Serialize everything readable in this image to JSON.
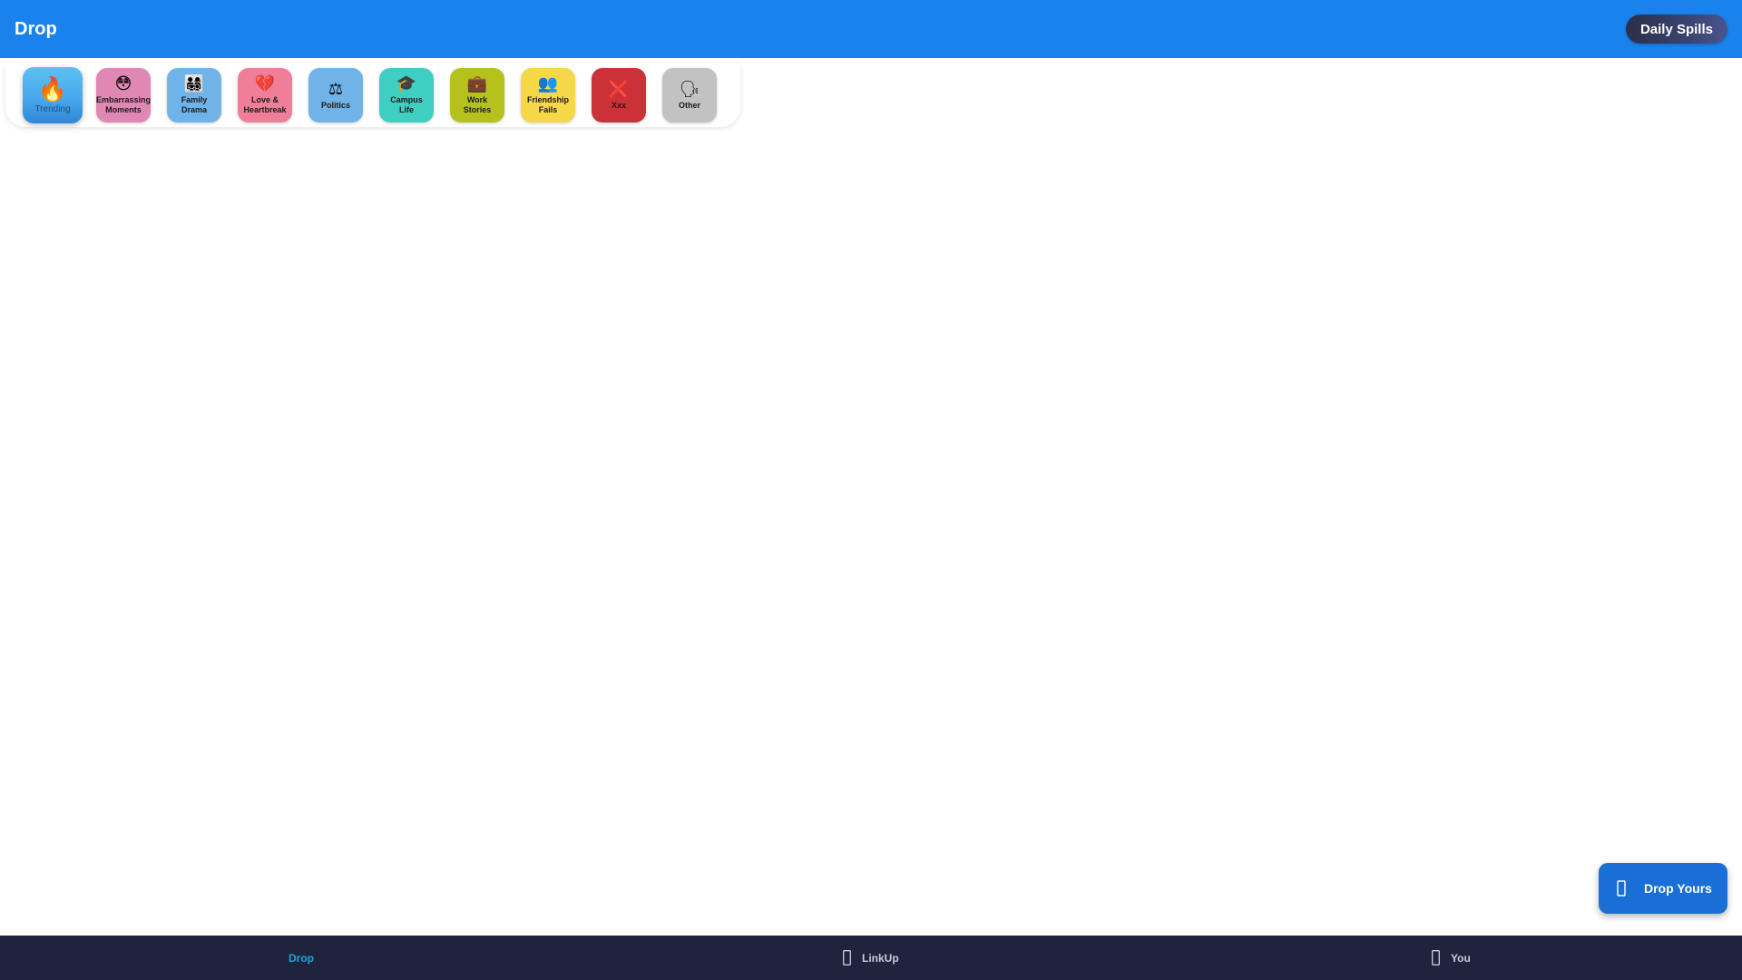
{
  "header": {
    "title": "Drop",
    "daily_spills_label": "Daily Spills"
  },
  "categories": [
    {
      "label": "Trending",
      "emoji": "🔥",
      "icon": "fire-icon",
      "color": "#4aa8ec",
      "active": true
    },
    {
      "label": "Embarrassing\nMoments",
      "emoji": "😳",
      "icon": "flushed-face-icon",
      "color": "#e088b4",
      "active": false
    },
    {
      "label": "Family\nDrama",
      "emoji": "👨‍👩‍👧‍👦",
      "icon": "family-icon",
      "color": "#6fb3e8",
      "active": false
    },
    {
      "label": "Love &\nHeartbreak",
      "emoji": "💔",
      "icon": "broken-heart-icon",
      "color": "#f07e98",
      "active": false
    },
    {
      "label": "Politics",
      "emoji": "⚖",
      "icon": "scales-icon",
      "color": "#6fb3e8",
      "active": false
    },
    {
      "label": "Campus\nLife",
      "emoji": "🎓",
      "icon": "graduation-cap-icon",
      "color": "#3fcfc2",
      "active": false
    },
    {
      "label": "Work\nStories",
      "emoji": "💼",
      "icon": "briefcase-icon",
      "color": "#b5c21e",
      "active": false
    },
    {
      "label": "Friendship\nFails",
      "emoji": "👥",
      "icon": "people-icon",
      "color": "#f6d748",
      "active": false
    },
    {
      "label": "Xxx",
      "emoji": "❌",
      "icon": "cross-mark-icon",
      "color": "#cc3138",
      "active": false
    },
    {
      "label": "Other",
      "emoji": "🗣",
      "icon": "speaking-head-icon",
      "color": "#c2c2c2",
      "active": false
    }
  ],
  "fab": {
    "label": "Drop Yours",
    "icon": "pen-icon"
  },
  "bottom_nav": [
    {
      "label": "Drop",
      "icon": "",
      "active": true
    },
    {
      "label": "LinkUp",
      "icon": "phone-icon",
      "active": false
    },
    {
      "label": "You",
      "icon": "phone-icon",
      "active": false
    }
  ],
  "colors": {
    "header": "#1a82ec",
    "bottom_nav": "#20233d",
    "nav_active": "#1ba6d6",
    "fab": "#1a6fd6"
  }
}
